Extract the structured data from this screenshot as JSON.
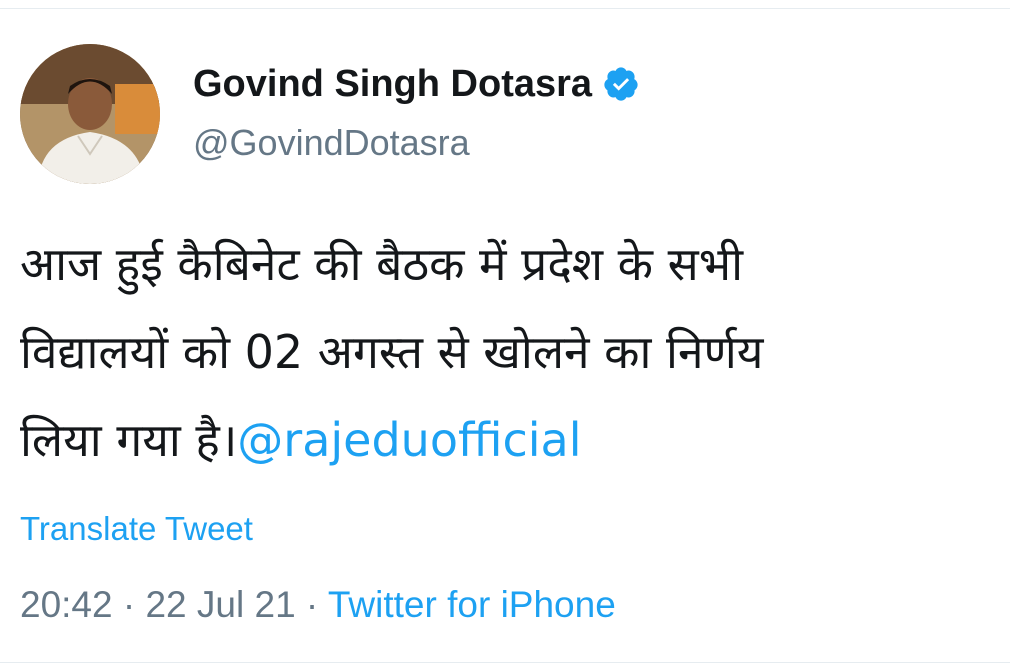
{
  "author": {
    "display_name": "Govind Singh Dotasra",
    "handle": "@GovindDotasra",
    "verified_icon": "verified-badge-icon",
    "avatar_icon": "avatar"
  },
  "tweet": {
    "lines": [
      "आज हुई कैबिनेट की बैठक में प्रदेश के सभी",
      "विद्यालयों को 02 अगस्त से खोलने का निर्णय",
      "लिया गया है।"
    ],
    "mention": "@rajeduofficial"
  },
  "translate_label": "Translate Tweet",
  "meta": {
    "time": "20:42",
    "separator_1": " · ",
    "date": "22 Jul 21",
    "separator_2": " · ",
    "source": "Twitter for iPhone"
  },
  "colors": {
    "accent": "#1da1f2",
    "muted": "#657786",
    "text": "#14171a"
  }
}
